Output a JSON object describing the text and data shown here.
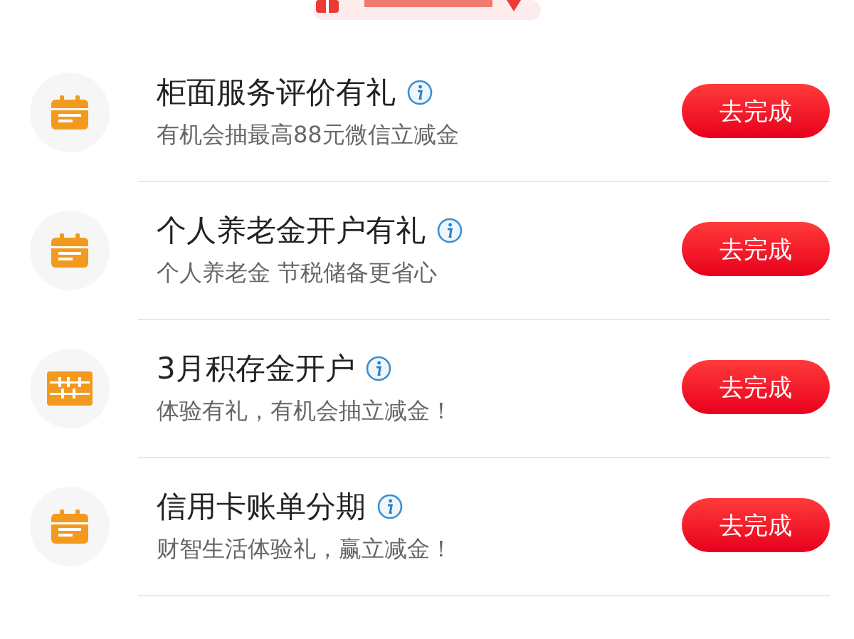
{
  "tasks": [
    {
      "kind": "calendar",
      "title": "柜面服务评价有礼",
      "subtitle": "有机会抽最高88元微信立减金",
      "button": "去完成"
    },
    {
      "kind": "calendar",
      "title": "个人养老金开户有礼",
      "subtitle": "个人养老金 节税储备更省心",
      "button": "去完成"
    },
    {
      "kind": "abacus",
      "title": "3月积存金开户",
      "subtitle": "体验有礼，有机会抽立减金！",
      "button": "去完成"
    },
    {
      "kind": "calendar",
      "title": "信用卡账单分期",
      "subtitle": "财智生活体验礼，赢立减金！",
      "button": "去完成"
    }
  ]
}
